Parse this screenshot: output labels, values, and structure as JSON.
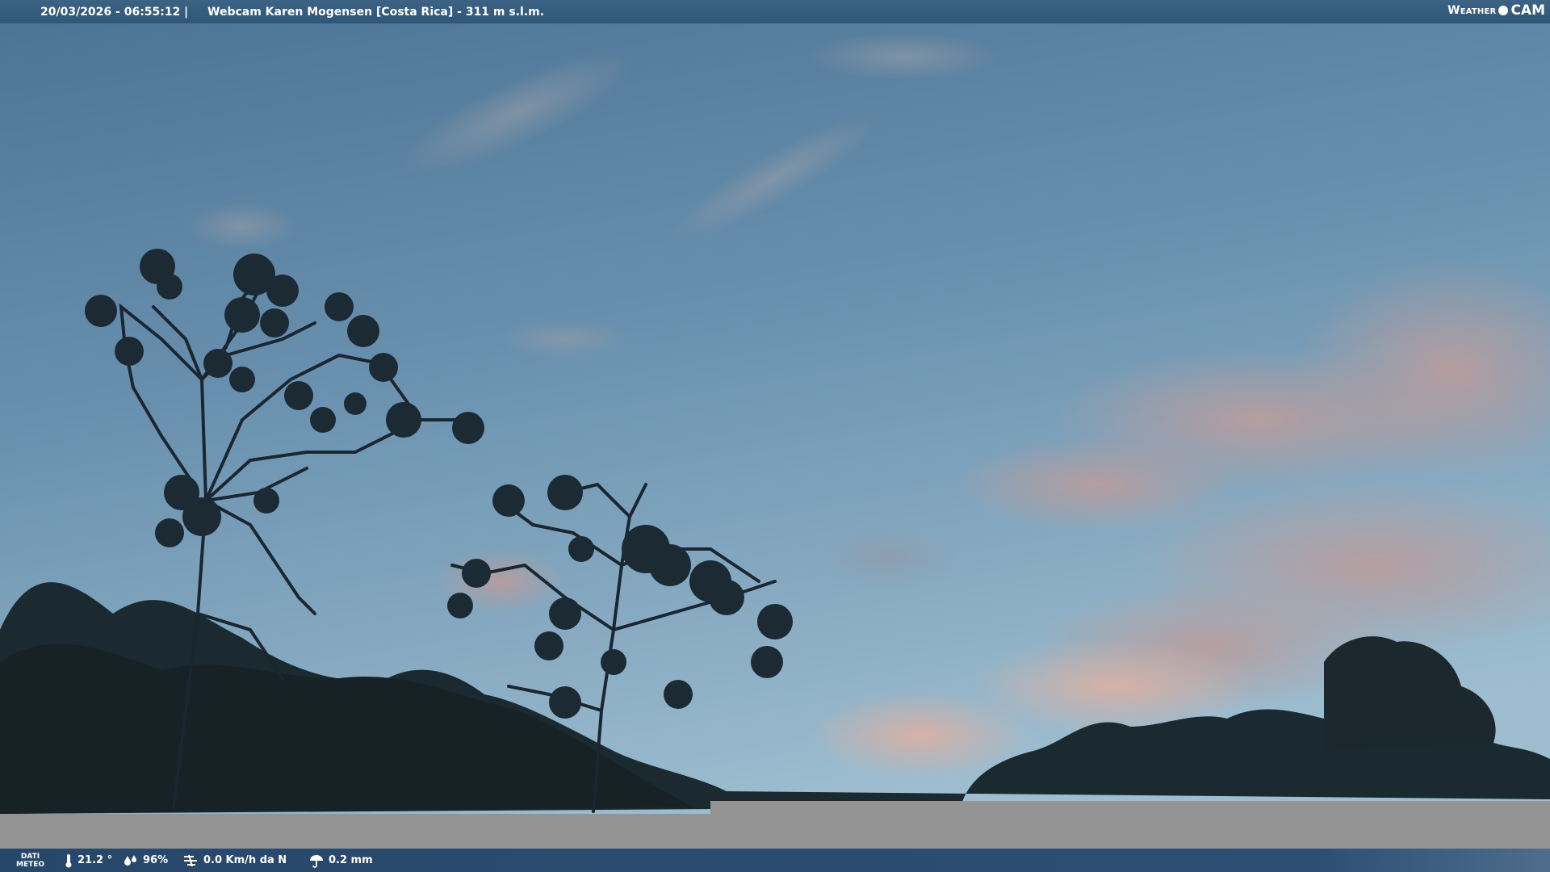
{
  "header": {
    "datetime": "20/03/2026 - 06:55:12",
    "separator": "|",
    "title": "Webcam Karen Mogensen [Costa Rica]  - 311 m s.l.m."
  },
  "logo": {
    "part1": "Weather",
    "part2": "CAM"
  },
  "footer": {
    "dati_line1": "DATI",
    "dati_line2": "METEO",
    "temperature": "21.2 °",
    "humidity": "96%",
    "wind": "0.0 Km/h da N",
    "rain": "0.2 mm"
  },
  "colors": {
    "bar": "#2f5676",
    "sky_top": "#4f7597",
    "sky_bottom": "#8fb2c9",
    "cloud_pink": "#c9a8a4"
  }
}
